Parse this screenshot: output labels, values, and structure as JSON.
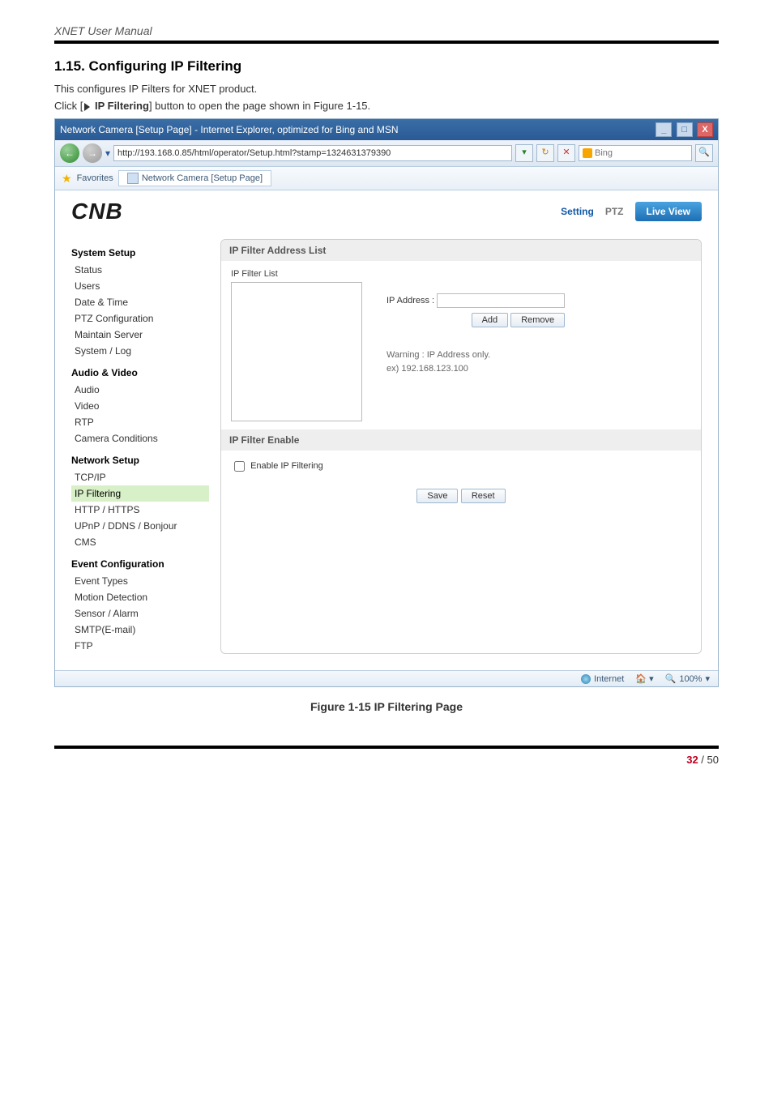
{
  "doc": {
    "running_header": "XNET User Manual",
    "section_number": "1.15.",
    "section_title": "Configuring IP Filtering",
    "intro_line": "This configures IP Filters for XNET product.",
    "click_prefix": "Click [",
    "click_bold": " IP Filtering",
    "click_suffix": "] button to open the page shown in Figure 1-15.",
    "figure_caption": "Figure 1-15 IP Filtering Page",
    "page_current": "32",
    "page_sep": " / ",
    "page_total": "50"
  },
  "browser": {
    "window_title": "Network Camera [Setup Page] - Internet Explorer, optimized for Bing and MSN",
    "url": "http://193.168.0.85/html/operator/Setup.html?stamp=1324631379390",
    "search_placeholder": "Bing",
    "favorites_label": "Favorites",
    "tab_label": "Network Camera [Setup Page]",
    "status_zone": "Internet",
    "status_zoom": "100%"
  },
  "topnav": {
    "logo": "CNB",
    "setting": "Setting",
    "ptz": "PTZ",
    "live": "Live View"
  },
  "sidebar": {
    "g1_title": "System Setup",
    "g1_items": [
      "Status",
      "Users",
      "Date & Time",
      "PTZ Configuration",
      "Maintain Server",
      "System / Log"
    ],
    "g2_title": "Audio & Video",
    "g2_items": [
      "Audio",
      "Video",
      "RTP",
      "Camera Conditions"
    ],
    "g3_title": "Network Setup",
    "g3_items": [
      "TCP/IP",
      "IP Filtering",
      "HTTP / HTTPS",
      "UPnP / DDNS / Bonjour",
      "CMS"
    ],
    "g4_title": "Event Configuration",
    "g4_items": [
      "Event Types",
      "Motion Detection",
      "Sensor / Alarm",
      "SMTP(E-mail)",
      "FTP"
    ]
  },
  "panel": {
    "sec1_title": "IP Filter Address List",
    "list_label": "IP Filter List",
    "ip_label": "IP Address :",
    "add": "Add",
    "remove": "Remove",
    "warn1": "Warning : IP Address only.",
    "warn2": "ex) 192.168.123.100",
    "sec2_title": "IP Filter Enable",
    "enable_label": "Enable IP Filtering",
    "save": "Save",
    "reset": "Reset"
  }
}
